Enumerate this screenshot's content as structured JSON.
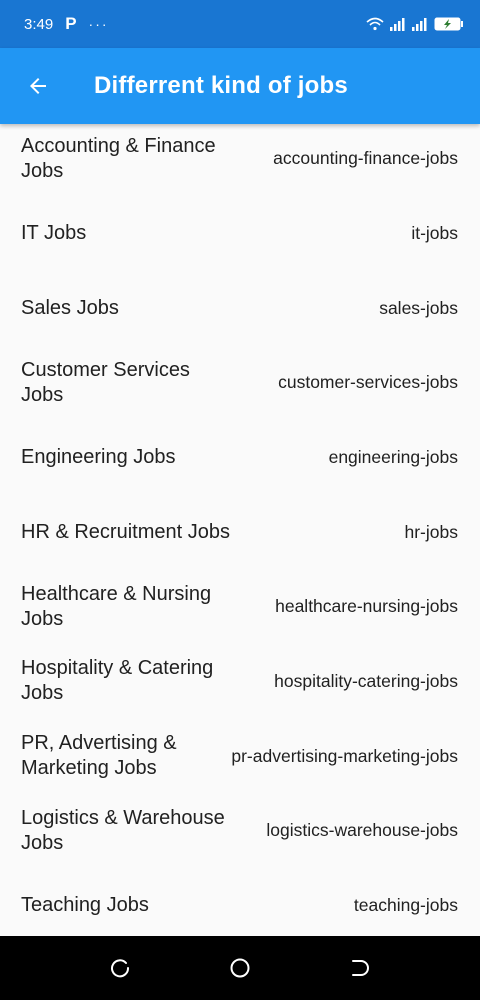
{
  "status_bar": {
    "time": "3:49",
    "app_icon": "P",
    "more": "···",
    "icons": [
      "wifi-icon",
      "signal-icon",
      "signal-icon",
      "battery-charging-icon"
    ]
  },
  "app_bar": {
    "title": "Differrent kind of jobs",
    "back_icon": "arrow-back-icon"
  },
  "colors": {
    "status_bar": "#1976d2",
    "app_bar": "#2196f3",
    "background": "#fafafa"
  },
  "jobs": [
    {
      "title": "Accounting & Finance Jobs",
      "slug": "accounting-finance-jobs"
    },
    {
      "title": "IT Jobs",
      "slug": "it-jobs"
    },
    {
      "title": "Sales Jobs",
      "slug": "sales-jobs"
    },
    {
      "title": "Customer Services Jobs",
      "slug": "customer-services-jobs"
    },
    {
      "title": "Engineering Jobs",
      "slug": "engineering-jobs"
    },
    {
      "title": "HR & Recruitment Jobs",
      "slug": "hr-jobs"
    },
    {
      "title": "Healthcare & Nursing Jobs",
      "slug": "healthcare-nursing-jobs"
    },
    {
      "title": "Hospitality & Catering Jobs",
      "slug": "hospitality-catering-jobs"
    },
    {
      "title": "PR, Advertising & Marketing Jobs",
      "slug": "pr-advertising-marketing-jobs"
    },
    {
      "title": "Logistics & Warehouse Jobs",
      "slug": "logistics-warehouse-jobs"
    },
    {
      "title": "Teaching Jobs",
      "slug": "teaching-jobs"
    }
  ],
  "nav_bar": {
    "icons": [
      "recent-apps-icon",
      "home-icon",
      "back-icon"
    ]
  }
}
